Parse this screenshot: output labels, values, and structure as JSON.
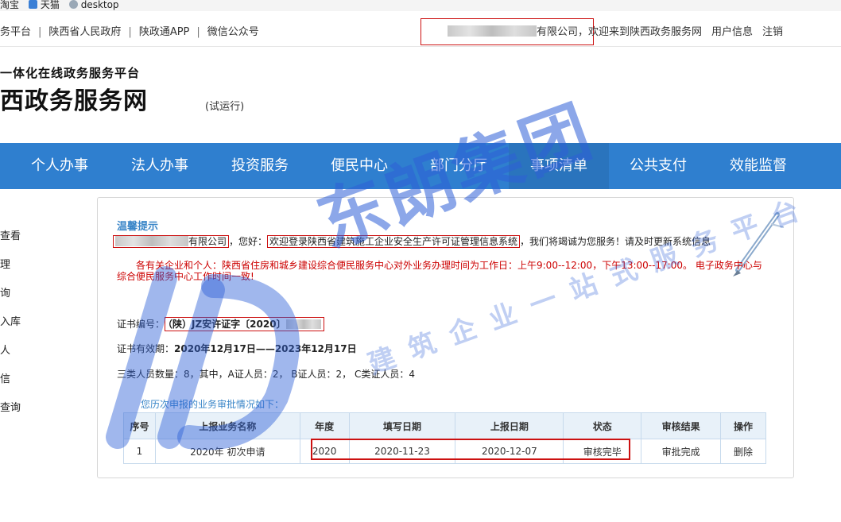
{
  "bookmarks": [
    "淘宝",
    "天猫",
    "desktop"
  ],
  "top_links": [
    "务平台",
    "陕西省人民政府",
    "陕政通APP",
    "微信公众号"
  ],
  "user": {
    "company_suffix": "有限公司",
    "welcome": "，欢迎来到陕西政务服务网",
    "info_link": "用户信息",
    "logout_link": "注销"
  },
  "logo": {
    "subtitle": "一体化在线政务服务平台",
    "title": "西政务服务网",
    "note": "(试运行)"
  },
  "nav": [
    "个人办事",
    "法人办事",
    "投资服务",
    "便民中心",
    "部门分厅",
    "事项清单",
    "公共支付",
    "效能监督"
  ],
  "sidebar": [
    "查看",
    "理",
    "询",
    "入库",
    "人",
    "信",
    "查询"
  ],
  "tip": {
    "title": "温馨提示",
    "company_suffix": "有限公司",
    "hello": "，您好：",
    "welcome_system": "欢迎登录陕西省建筑施工企业安全生产许可证管理信息系统",
    "service": "，我们将竭诚为您服务！请及时更新系统信息",
    "notice": "各有关企业和个人：陕西省住房和城乡建设综合便民服务中心对外业务办理时间为工作日：上午9:00--12:00，下午13:00--17:00。 电子政务中心与综合便民服务中心工作时间一致!"
  },
  "cert": {
    "number_label": "证书编号：",
    "number_value": "（陕）JZ安许证字〔2020〕",
    "valid_label": "证书有效期：",
    "valid_value": "2020年12月17日——2023年12月17日",
    "staff_text": "三类人员数量：8，其中，A证人员：2， B证人员：2， C类证人员：4"
  },
  "history": {
    "title": "您历次申报的业务审批情况如下：",
    "columns": [
      "序号",
      "上报业务名称",
      "年度",
      "填写日期",
      "上报日期",
      "状态",
      "审核结果",
      "操作"
    ],
    "rows": [
      {
        "no": "1",
        "name": "2020年 初次申请",
        "year": "2020",
        "fill_date": "2020-11-23",
        "submit_date": "2020-12-07",
        "status": "审核完毕",
        "result": "审批完成",
        "action": "删除"
      }
    ]
  },
  "watermark": {
    "brand": "东朗集团",
    "slogan": "建筑企业一站式服务平台"
  },
  "colors": {
    "nav_bg": "#2f7fcf",
    "link": "#2d7cc7",
    "highlight_box": "#cc1111",
    "notice_text": "#cc0000",
    "watermark": "#2d5fd7"
  }
}
